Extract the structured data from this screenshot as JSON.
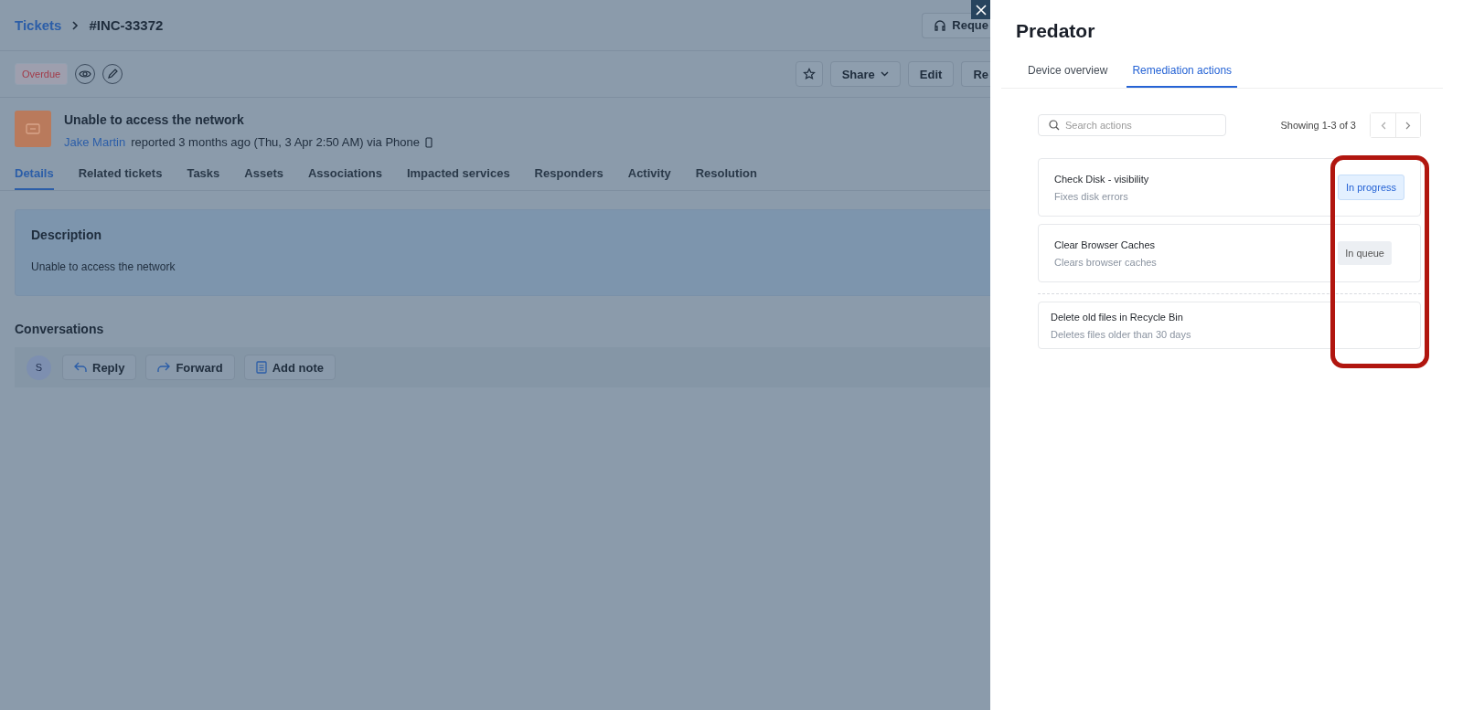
{
  "breadcrumb": {
    "parent": "Tickets",
    "current": "#INC-33372"
  },
  "header_button": {
    "label": "Reque"
  },
  "status_tag": "Overdue",
  "toolbar": {
    "buttons": [
      {
        "label": "Share",
        "kind": "dropdown"
      },
      {
        "label": "Edit",
        "kind": "plain"
      },
      {
        "label": "Re",
        "kind": "cut"
      }
    ]
  },
  "ticket": {
    "subject": "Unable to access the network",
    "requester": "Jake Martin",
    "meta": "reported 3 months ago (Thu, 3 Apr 2:50 AM) via Phone"
  },
  "tabs": [
    {
      "label": "Details",
      "selected": true
    },
    {
      "label": "Related tickets",
      "selected": false
    },
    {
      "label": "Tasks",
      "selected": false
    },
    {
      "label": "Assets",
      "selected": false
    },
    {
      "label": "Associations",
      "selected": false
    },
    {
      "label": "Impacted services",
      "selected": false
    },
    {
      "label": "Responders",
      "selected": false
    },
    {
      "label": "Activity",
      "selected": false
    },
    {
      "label": "Resolution",
      "selected": false
    }
  ],
  "description": {
    "title": "Description",
    "text": "Unable to access the network"
  },
  "conversations": {
    "title": "Conversations",
    "avatar": "S",
    "actions": [
      {
        "label": "Reply",
        "kind": "reply"
      },
      {
        "label": "Forward",
        "kind": "forward"
      },
      {
        "label": "Add note",
        "kind": "note"
      }
    ]
  },
  "drawer": {
    "title": "Predator",
    "tabs": [
      {
        "label": "Device overview",
        "selected": false
      },
      {
        "label": "Remediation actions",
        "selected": true
      }
    ],
    "search": {
      "placeholder": "Search actions"
    },
    "showing": "Showing 1-3 of 3",
    "actions": [
      {
        "name": "Check Disk - visibility",
        "description": "Fixes disk errors",
        "status": {
          "label": "In progress",
          "kind": "in_progress"
        }
      },
      {
        "name": "Clear Browser Caches",
        "description": "Clears browser caches",
        "status": {
          "label": "In queue",
          "kind": "queued"
        }
      },
      {
        "name": "Delete old files in Recycle Bin",
        "description": "Deletes files older than 30 days",
        "separated": true
      }
    ]
  }
}
